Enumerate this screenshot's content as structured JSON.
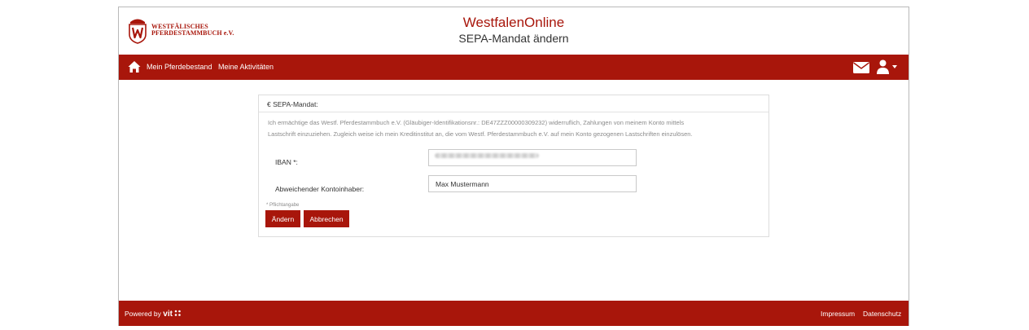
{
  "header": {
    "logo_line1": "WESTFÄLISCHES",
    "logo_line2": "PFERDESTAMMBUCH e.V.",
    "app_title": "WestfalenOnline",
    "page_title": "SEPA-Mandat ändern"
  },
  "nav": {
    "items": [
      "Mein Pferdebestand",
      "Meine Aktivitäten"
    ],
    "icons": [
      "home-icon",
      "mail-icon",
      "user-icon",
      "caret-down-icon"
    ]
  },
  "form": {
    "heading": "€ SEPA-Mandat:",
    "description_line1": "Ich ermächtige das Westf. Pferdestammbuch e.V. (Gläubiger-Identifikationsnr.: DE47ZZZ00000309232) widerruflich, Zahlungen von meinem Konto mittels",
    "description_line2": "Lastschrift einzuziehen. Zugleich weise ich mein Kreditinstitut an, die vom Westf. Pferdestammbuch e.V. auf mein Konto gezogenen Lastschriften einzulösen.",
    "iban_label": "IBAN *:",
    "iban_value": "",
    "holder_label": "Abweichender Kontoinhaber:",
    "holder_value": "Max Mustermann",
    "required_note": "* Pflichtangabe",
    "submit_label": "Ändern",
    "cancel_label": "Abbrechen"
  },
  "footer": {
    "powered_by": "Powered by",
    "powered_logo": "vit",
    "links": [
      "Impressum",
      "Datenschutz"
    ]
  },
  "colors": {
    "brand": "#a8160b"
  }
}
